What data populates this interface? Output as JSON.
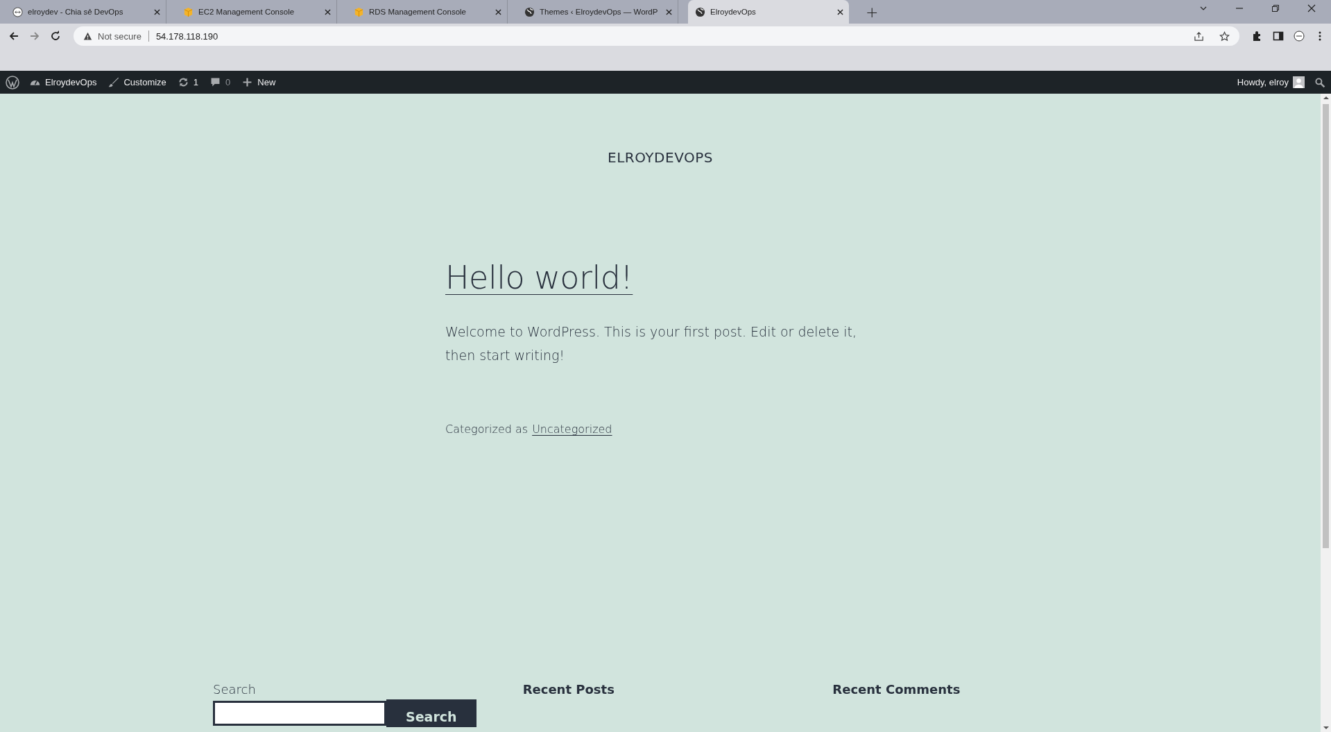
{
  "browser": {
    "tabs": [
      {
        "title": "elroydev - Chia sẻ DevOps",
        "kind": "site",
        "selected": false
      },
      {
        "title": "EC2 Management Console",
        "kind": "aws",
        "selected": false
      },
      {
        "title": "RDS Management Console",
        "kind": "aws",
        "selected": false
      },
      {
        "title": "Themes ‹ ElroydevOps — WordP",
        "kind": "globe",
        "selected": false
      },
      {
        "title": "ElroydevOps",
        "kind": "globe",
        "selected": true
      }
    ],
    "new_tab": "+",
    "security": "Not secure",
    "url": "54.178.118.190"
  },
  "admin_bar": {
    "items": [
      {
        "kind": "site",
        "label": "ElroydevOps"
      },
      {
        "kind": "customize",
        "label": "Customize"
      },
      {
        "kind": "updates",
        "label": "1"
      },
      {
        "kind": "comments",
        "label": "0"
      },
      {
        "kind": "new",
        "label": "New"
      }
    ],
    "greeting": "Howdy, elroy"
  },
  "site_title": "ELROYDEVOPS",
  "post": {
    "title": "Hello world!",
    "body": "Welcome to WordPress. This is your first post. Edit or delete it, then start writing!",
    "category_prefix": "Categorized as",
    "category": "Uncategorized"
  },
  "footer": {
    "search_label": "Search",
    "search_button": "Search",
    "widgets": [
      "Recent Posts",
      "Recent Comments"
    ]
  }
}
